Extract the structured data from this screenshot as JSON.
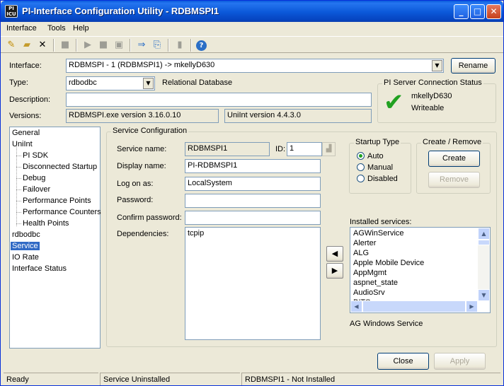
{
  "window": {
    "title": "PI-Interface Configuration Utility - RDBMSPI1",
    "icon_text": "PI ICU"
  },
  "menu": [
    "Interface",
    "Tools",
    "Help"
  ],
  "interface_row": {
    "label": "Interface:",
    "value": "RDBMSPI - 1 (RDBMSPI1) -> mkellyD630",
    "rename_label": "Rename"
  },
  "type_row": {
    "label": "Type:",
    "value": "rdbodbc",
    "description": "Relational Database"
  },
  "description_row": {
    "label": "Description:",
    "value": ""
  },
  "versions_row": {
    "label": "Versions:",
    "exe_version": "RDBMSPI.exe version 3.16.0.10",
    "uniint_version": "UniInt version 4.4.3.0"
  },
  "server_status": {
    "title": "PI Server Connection Status",
    "server": "mkellyD630",
    "status": "Writeable"
  },
  "tree": {
    "items": [
      {
        "label": "General",
        "level": 0
      },
      {
        "label": "UniInt",
        "level": 0
      },
      {
        "label": "PI SDK",
        "level": 1
      },
      {
        "label": "Disconnected Startup",
        "level": 1
      },
      {
        "label": "Debug",
        "level": 1
      },
      {
        "label": "Failover",
        "level": 1
      },
      {
        "label": "Performance Points",
        "level": 1
      },
      {
        "label": "Performance Counters",
        "level": 1
      },
      {
        "label": "Health Points",
        "level": 1
      },
      {
        "label": "rdbodbc",
        "level": 0
      },
      {
        "label": "Service",
        "level": 0,
        "selected": true
      },
      {
        "label": "IO Rate",
        "level": 0
      },
      {
        "label": "Interface Status",
        "level": 0
      }
    ]
  },
  "service_config": {
    "title": "Service Configuration",
    "service_name_label": "Service name:",
    "service_name": "RDBMSPI1",
    "id_label": "ID:",
    "id_value": "1",
    "display_name_label": "Display name:",
    "display_name": "PI-RDBMSPI1",
    "logon_label": "Log on as:",
    "logon_value": "LocalSystem",
    "password_label": "Password:",
    "password_value": "",
    "confirm_label": "Confirm password:",
    "confirm_value": "",
    "dependencies_label": "Dependencies:",
    "dependencies": [
      "tcpip"
    ]
  },
  "startup_type": {
    "title": "Startup Type",
    "options": [
      "Auto",
      "Manual",
      "Disabled"
    ],
    "selected": "Auto"
  },
  "create_remove": {
    "title": "Create / Remove",
    "create_label": "Create",
    "remove_label": "Remove"
  },
  "installed_services": {
    "label": "Installed services:",
    "items": [
      "AGWinService",
      "Alerter",
      "ALG",
      "Apple Mobile Device",
      "AppMgmt",
      "aspnet_state",
      "AudioSrv",
      "BITS"
    ],
    "selected_description": "AG Windows Service"
  },
  "buttons": {
    "close_label": "Close",
    "apply_label": "Apply"
  },
  "status_bar": [
    "Ready",
    "Service Uninstalled",
    "RDBMSPI1 - Not Installed"
  ],
  "icons": {
    "arrow_left": "◀",
    "arrow_right": "▶",
    "checkmark": "✔",
    "new": "✎",
    "open": "📂",
    "delete": "✕",
    "save": "■",
    "start": "▶",
    "stop": "■",
    "help": "?"
  },
  "colors": {
    "selection": "#316ac5",
    "check_green": "#21a121",
    "titlebar": "#0a5bdc"
  }
}
